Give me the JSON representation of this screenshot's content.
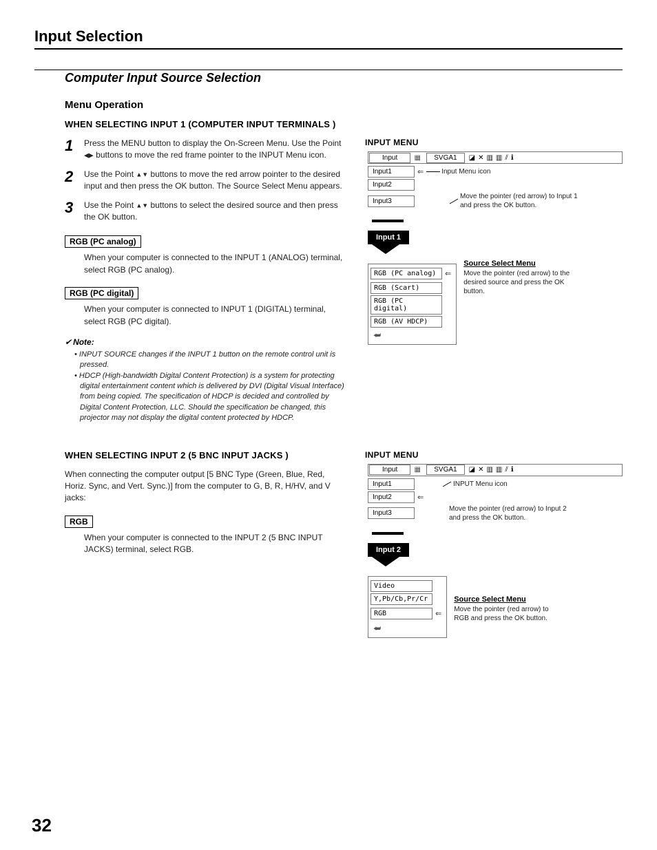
{
  "section_title": "Input Selection",
  "subsection": "Computer Input Source Selection",
  "menu_operation": "Menu Operation",
  "when1": "WHEN SELECTING INPUT 1 (COMPUTER INPUT TERMINALS )",
  "steps": [
    {
      "num": "1",
      "text_a": "Press the MENU button to display the On-Screen Menu. Use the Point ",
      "text_b": " buttons to move the red frame pointer to the INPUT Menu icon."
    },
    {
      "num": "2",
      "text_a": "Use the Point ",
      "text_b": " buttons to move the red arrow pointer to the desired input and then press the OK button. The Source Select Menu appears."
    },
    {
      "num": "3",
      "text_a": "Use the Point ",
      "text_b": " buttons to select the desired source and then press the OK button."
    }
  ],
  "rgb_analog_label": "RGB (PC analog)",
  "rgb_analog_desc": "When your computer is connected to the INPUT 1 (ANALOG) terminal, select RGB (PC analog).",
  "rgb_digital_label": "RGB (PC digital)",
  "rgb_digital_desc": "When your computer is connected to INPUT 1 (DIGITAL) terminal, select RGB (PC digital).",
  "note_head": "Note:",
  "notes": [
    "• INPUT SOURCE changes if the INPUT 1 button on the remote control unit is pressed.",
    "• HDCP (High-bandwidth Digital Content Protection) is a system for protecting digital entertainment content which is delivered by DVI (Digital Visual Interface) from being copied. The specification of HDCP is decided and controlled by Digital Content Protection, LLC. Should the specification be changed, this projector may not display the digital content protected by HDCP."
  ],
  "when2": "WHEN SELECTING INPUT 2 (5 BNC INPUT JACKS )",
  "bnc_intro": "When connecting the computer output [5 BNC Type (Green, Blue, Red, Horiz. Sync, and Vert. Sync.)] from the computer to G, B, R, H/HV, and V jacks:",
  "rgb_label": "RGB",
  "rgb_desc": "When your computer is connected to the INPUT 2 (5 BNC INPUT JACKS) terminal, select RGB.",
  "input_menu_label": "INPUT MENU",
  "diag1": {
    "tab": "Input",
    "svga": "SVGA1",
    "inputs": [
      "Input1",
      "Input2",
      "Input3"
    ],
    "annot_icon": "Input Menu icon",
    "annot_move": "Move the pointer (red arrow) to Input 1 and press the OK button.",
    "black": "Input 1",
    "src_title": "Source Select Menu",
    "src_items": [
      "RGB (PC analog)",
      "RGB (Scart)",
      "RGB (PC digital)",
      "RGB (AV HDCP)"
    ],
    "src_annot": "Move the pointer (red arrow) to the desired source and press the OK button."
  },
  "diag2": {
    "tab": "Input",
    "svga": "SVGA1",
    "inputs": [
      "Input1",
      "Input2",
      "Input3"
    ],
    "annot_icon": "INPUT Menu icon",
    "annot_move": "Move the pointer (red arrow) to Input 2 and press the OK button.",
    "black": "Input 2",
    "src_title": "Source Select Menu",
    "src_items": [
      "Video",
      "Y,Pb/Cb,Pr/Cr",
      "RGB"
    ],
    "src_annot": "Move the pointer (red arrow) to RGB and press the OK button."
  },
  "page_number": "32"
}
